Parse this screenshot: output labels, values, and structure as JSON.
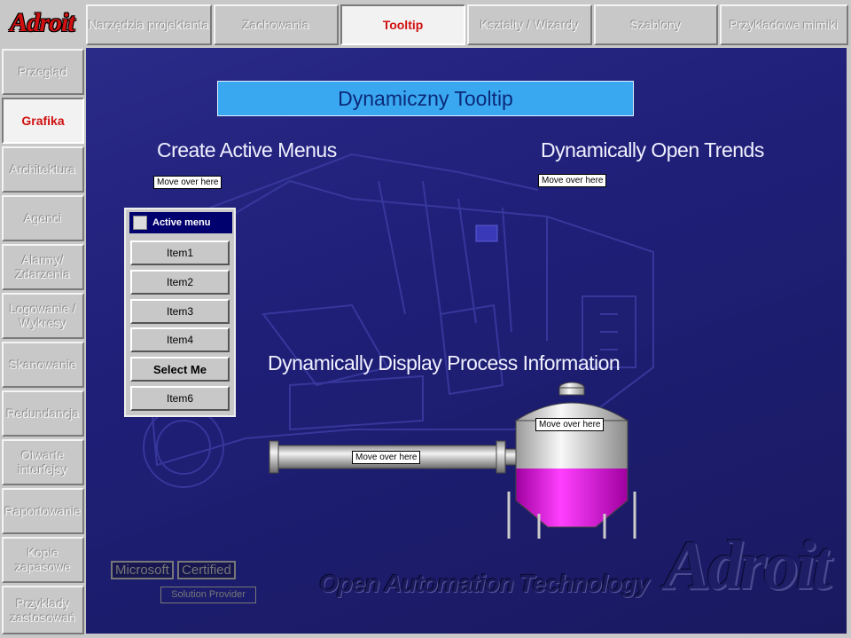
{
  "logo": {
    "text": "Adroit"
  },
  "tabs": [
    {
      "label": "Narzędzia projektanta",
      "active": false
    },
    {
      "label": "Zachowania",
      "active": false
    },
    {
      "label": "Tooltip",
      "active": true
    },
    {
      "label": "Kształty / Wizardy",
      "active": false
    },
    {
      "label": "Szablony",
      "active": false
    },
    {
      "label": "Przykładowe mimiki",
      "active": false
    }
  ],
  "sidebar": [
    {
      "label": "Przegląd",
      "active": false
    },
    {
      "label": "Grafika",
      "active": true
    },
    {
      "label": "Architektura",
      "active": false
    },
    {
      "label": "Agenci",
      "active": false
    },
    {
      "label": "Alarmy/\nZdarzenia",
      "active": false
    },
    {
      "label": "Logowanie /\nWykresy",
      "active": false
    },
    {
      "label": "Skanowanie",
      "active": false
    },
    {
      "label": "Redundancja",
      "active": false
    },
    {
      "label": "Otwarte\ninterfejsy",
      "active": false
    },
    {
      "label": "Raportowanie",
      "active": false
    },
    {
      "label": "Kopie\nzapasowe",
      "active": false
    },
    {
      "label": "Przykłady\nzastosowań",
      "active": false
    }
  ],
  "main": {
    "header": "Dynamiczny Tooltip",
    "headings": {
      "menus": "Create Active Menus",
      "trends": "Dynamically Open Trends",
      "process": "Dynamically Display Process Information"
    },
    "tooltips": {
      "menus": "Move over here",
      "trends": "Move over here",
      "tank": "Move over here",
      "pipe": "Move over here"
    },
    "active_menu": {
      "title": "Active menu",
      "items": [
        "Item1",
        "Item2",
        "Item3",
        "Item4",
        "Select Me",
        "Item6"
      ]
    },
    "tank_fill_fraction": 0.55,
    "colors": {
      "background": "#1f1f78",
      "header_bg": "#3aa8f0",
      "tank_fill": "#d000d0",
      "active_tab_text": "#d01010"
    }
  },
  "footer": {
    "microsoft": "Microsoft",
    "certified": "Certified",
    "solution_provider": "Solution Provider",
    "tagline": "Open Automation Technology",
    "brand": "Adroit"
  }
}
